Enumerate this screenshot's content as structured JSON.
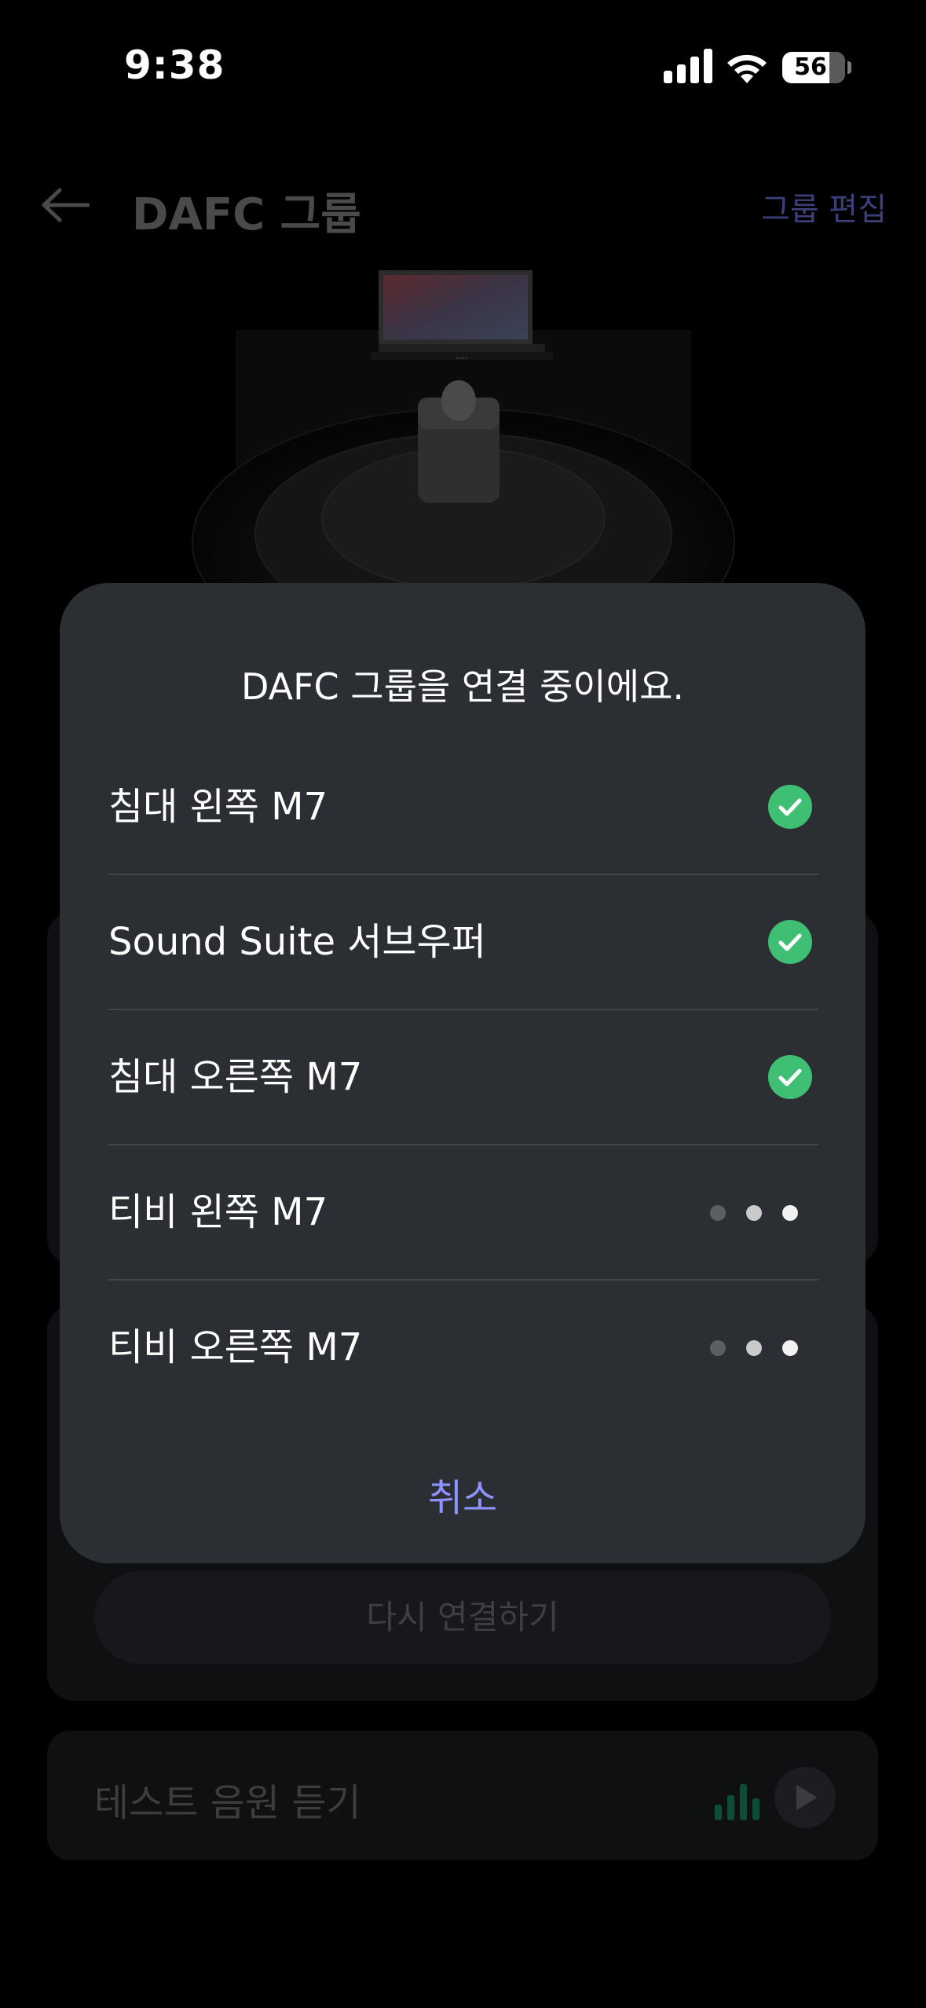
{
  "status_bar": {
    "time": "9:38",
    "battery_level": "56"
  },
  "header": {
    "title": "DAFC 그룹",
    "edit_label": "그룹 편집"
  },
  "background": {
    "reconnect_label": "다시 연결하기",
    "test_sound_label": "테스트 음원 듣기"
  },
  "modal": {
    "title": "DAFC 그룹을 연결 중이에요.",
    "devices": [
      {
        "name": "침대 왼쪽 M7",
        "status": "connected"
      },
      {
        "name": "Sound Suite 서브우퍼",
        "status": "connected"
      },
      {
        "name": "침대 오른쪽 M7",
        "status": "connected"
      },
      {
        "name": "티비 왼쪽 M7",
        "status": "connecting"
      },
      {
        "name": "티비 오른쪽 M7",
        "status": "connecting"
      }
    ],
    "cancel_label": "취소"
  },
  "colors": {
    "connected_green": "#3fbf74",
    "accent": "#8e92ff",
    "modal_bg": "#2b2e32"
  },
  "icons": [
    "signal-icon",
    "wifi-icon",
    "battery-icon",
    "back-arrow-icon",
    "check-circle-icon",
    "loading-dots-icon",
    "equalizer-icon",
    "play-icon"
  ]
}
